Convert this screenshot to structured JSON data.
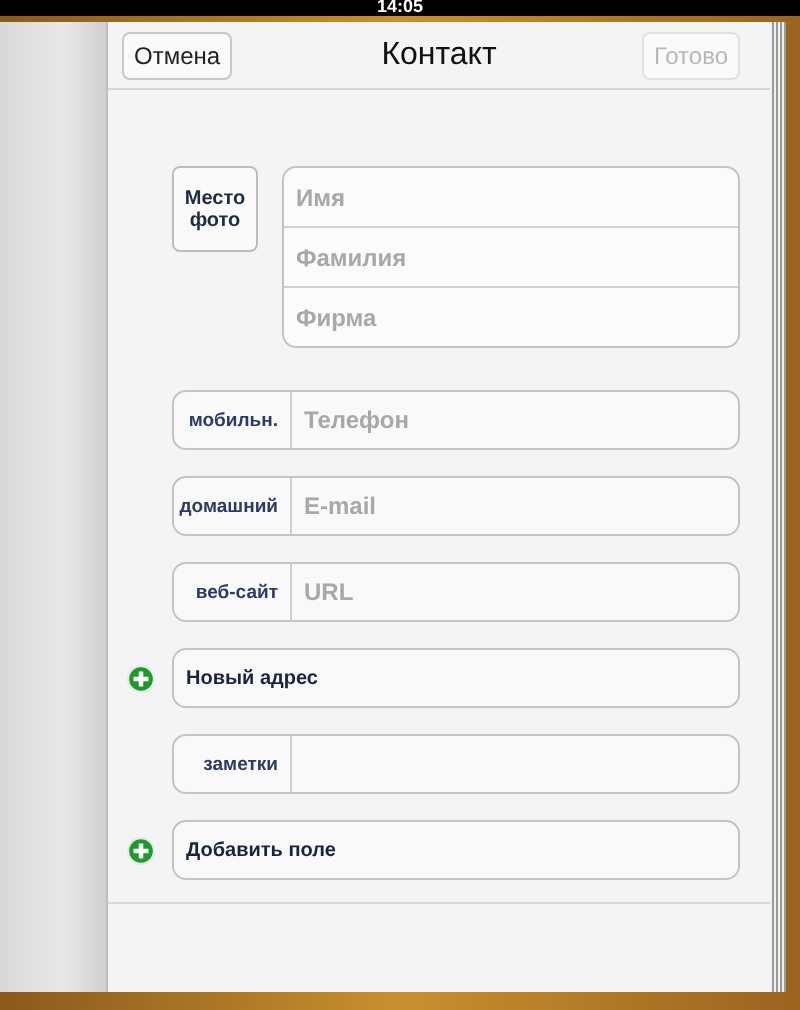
{
  "status_bar": {
    "time": "14:05"
  },
  "nav": {
    "cancel": "Отмена",
    "title": "Контакт",
    "done": {
      "label": "Готово",
      "disabled": true
    }
  },
  "photo": {
    "label": "Место фото"
  },
  "name_fields": [
    {
      "placeholder": "Имя"
    },
    {
      "placeholder": "Фамилия"
    },
    {
      "placeholder": "Фирма"
    }
  ],
  "rows": [
    {
      "kind": "field",
      "label": "мобильн.",
      "placeholder": "Телефон"
    },
    {
      "kind": "field",
      "label": "домашний",
      "placeholder": "E-mail"
    },
    {
      "kind": "field",
      "label": "веб-сайт",
      "placeholder": "URL"
    },
    {
      "kind": "add",
      "label": "Новый адрес"
    },
    {
      "kind": "field",
      "label": "заметки"
    },
    {
      "kind": "add",
      "label": "Добавить поле"
    }
  ]
}
